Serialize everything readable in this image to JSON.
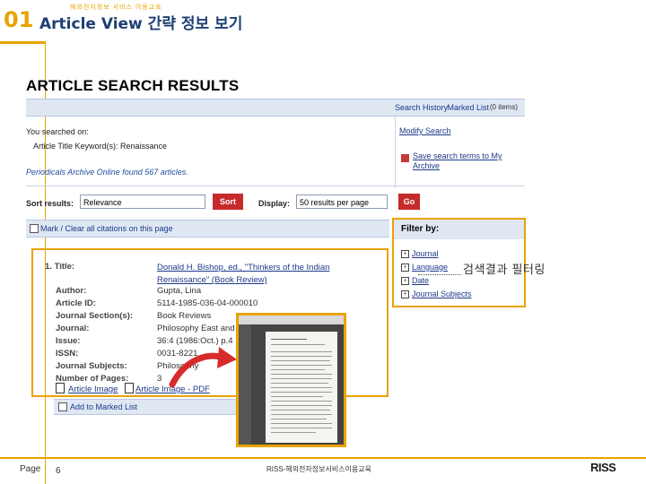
{
  "slide": {
    "number": "01",
    "title": "Article View 간략 정보 보기",
    "top_label": "해외전자정보 서비스 이용교육",
    "callout": "검색결과 필터링",
    "page_label": "Page",
    "page_number": "6",
    "footer_text": "RISS-해외전자정보서비스이용교육",
    "logo": "RISS"
  },
  "results": {
    "heading": "ARTICLE SEARCH RESULTS",
    "search_history": "Search History",
    "marked_list": "Marked List",
    "marked_count": "(0 items)",
    "you_searched": "You searched on:",
    "keyword": "Article Title Keyword(s): Renaissance",
    "found": "Periodicals Archive Online found 567 articles.",
    "modify_search": "Modify Search",
    "save_search": "Save search terms to My Archive",
    "sort_label": "Sort results:",
    "sort_value": "Relevance",
    "sort_button": "Sort",
    "display_label": "Display:",
    "display_value": "50 results per page",
    "go_button": "Go",
    "mark_clear": "Mark / Clear all citations on this page"
  },
  "filter": {
    "heading": "Filter by:",
    "items": [
      "Journal",
      "Language",
      "Date",
      "Journal Subjects"
    ]
  },
  "record": {
    "index": "1.",
    "title_label": "Title:",
    "title_value": "Donald H. Bishop, ed., \"Thinkers of the Indian Renaissance\" (Book Review)",
    "fields": [
      {
        "label": "Author:",
        "value": "Gupta, Lina"
      },
      {
        "label": "Article ID:",
        "value": "5114-1985-036-04-000010"
      },
      {
        "label": "Journal Section(s):",
        "value": "Book Reviews"
      },
      {
        "label": "Journal:",
        "value": "Philosophy East and"
      },
      {
        "label": "Issue:",
        "value": "36:4 (1986:Oct.) p.4"
      },
      {
        "label": "ISSN:",
        "value": "0031-8221"
      },
      {
        "label": "Journal Subjects:",
        "value": "Philosophy"
      },
      {
        "label": "Number of Pages:",
        "value": "3"
      }
    ],
    "article_image": "Article Image",
    "article_image_pdf": "Article Image - PDF",
    "add_marked": "Add to Marked List"
  }
}
